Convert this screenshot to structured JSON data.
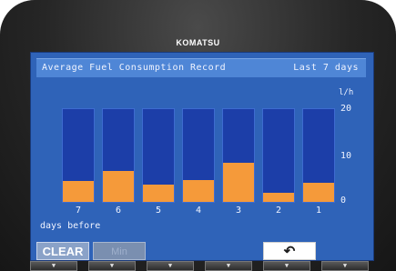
{
  "device": {
    "brand": "KOMATSU"
  },
  "screen": {
    "title": "Average Fuel Consumption Record",
    "range": "Last 7 days",
    "unit": "l/h",
    "x_caption": "days before"
  },
  "buttons": {
    "clear": "CLEAR",
    "min": "Min",
    "back_icon": "return-arrow-icon"
  },
  "colors": {
    "screen_bg": "#2f63b8",
    "column_bg": "#1c3ea8",
    "bar": "#f59a3a",
    "titlebar": "#4f86d6"
  },
  "function_keys": [
    "▼",
    "▼",
    "▼",
    "▼",
    "▼",
    "▼"
  ],
  "chart_data": {
    "type": "bar",
    "title": "Average Fuel Consumption Record",
    "subtitle": "Last 7 days",
    "categories": [
      "7",
      "6",
      "5",
      "4",
      "3",
      "2",
      "1"
    ],
    "values": [
      4.5,
      6.7,
      3.8,
      4.8,
      8.4,
      2.0,
      4.2
    ],
    "xlabel": "days before",
    "ylabel": "l/h",
    "ylim": [
      0,
      20
    ],
    "yticks": [
      "20",
      "10",
      "0"
    ],
    "grid": false,
    "legend": "none"
  }
}
